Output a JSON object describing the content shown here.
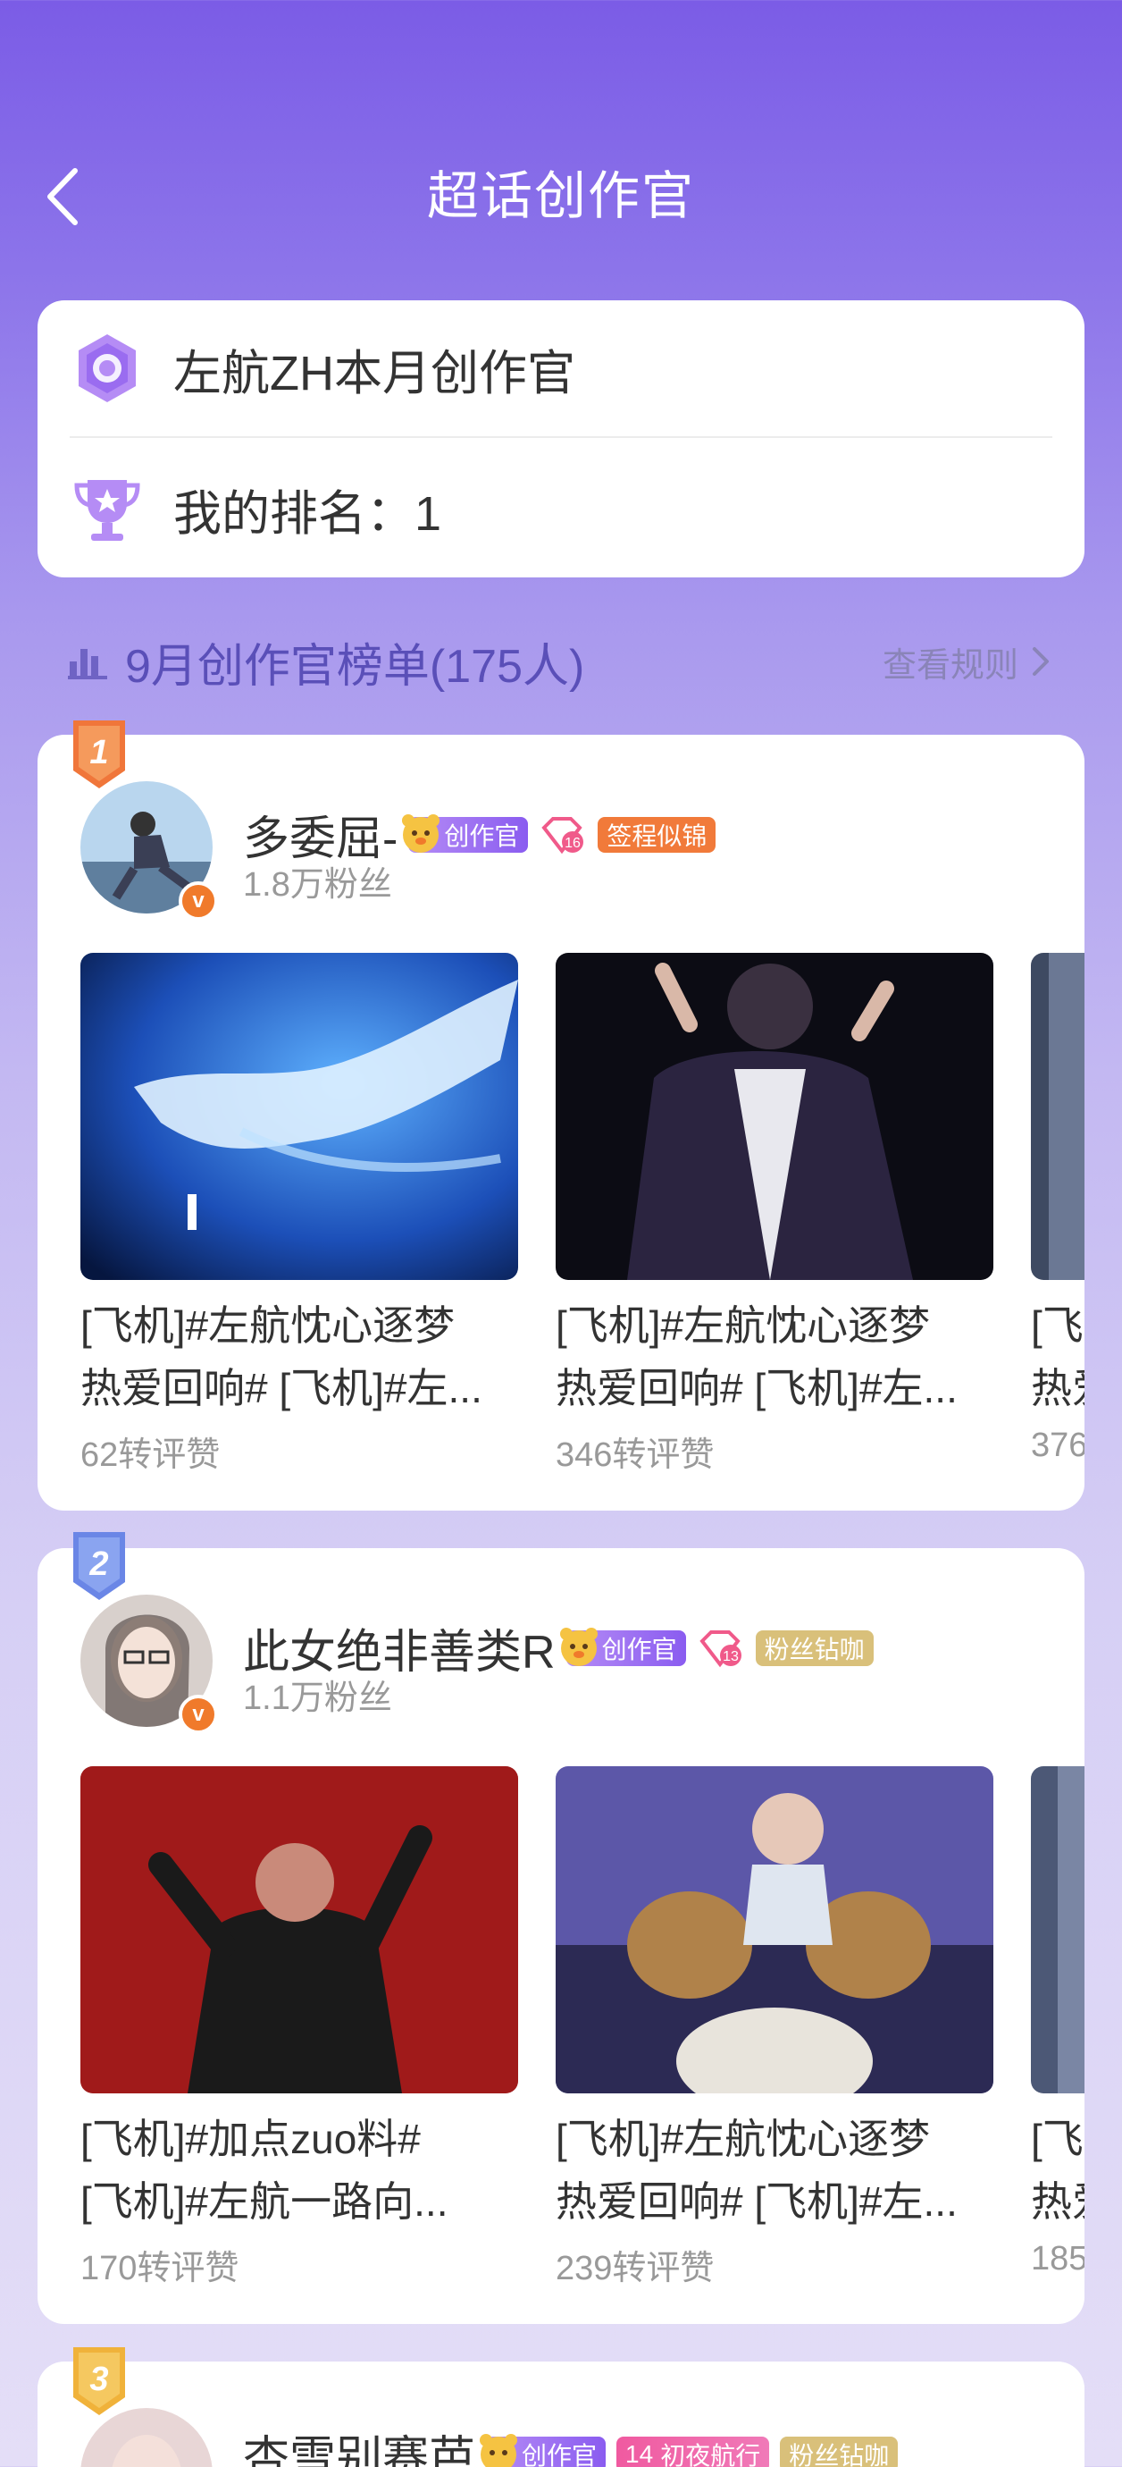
{
  "header": {
    "title": "超话创作官"
  },
  "info": {
    "creator_label": "左航ZH本月创作官",
    "rank_label": "我的排名：1"
  },
  "section": {
    "title": "9月创作官榜单(175人)",
    "rules_link": "查看规则"
  },
  "colors": {
    "accent": "#7b5ce6",
    "orange": "#f17a3a"
  },
  "ranking": [
    {
      "rank": "1",
      "name": "多委屈-",
      "fans": "1.8万粉丝",
      "creator_tag": "创作官",
      "level": "16",
      "badge": "签程似锦",
      "posts": [
        {
          "line1": "[飞机]#左航忱心逐梦",
          "line2": "热爱回响# [飞机]#左...",
          "stats": "62转评赞"
        },
        {
          "line1": "[飞机]#左航忱心逐梦",
          "line2": "热爱回响# [飞机]#左...",
          "stats": "346转评赞"
        },
        {
          "line1": "[飞",
          "line2": "热爱",
          "stats": "376"
        }
      ]
    },
    {
      "rank": "2",
      "name": "此女绝非善类R",
      "fans": "1.1万粉丝",
      "creator_tag": "创作官",
      "level": "13",
      "badge": "粉丝钻咖",
      "posts": [
        {
          "line1": "[飞机]#加点zuo料#",
          "line2": "[飞机]#左航一路向...",
          "stats": "170转评赞"
        },
        {
          "line1": "[飞机]#左航忱心逐梦",
          "line2": "热爱回响# [飞机]#左...",
          "stats": "239转评赞"
        },
        {
          "line1": "[飞",
          "line2": "热爱",
          "stats": "185"
        }
      ]
    },
    {
      "rank": "3",
      "name": "杏雪别赛芭",
      "creator_tag": "创作官",
      "level": "14",
      "badge": "初夜航行",
      "badge2": "粉丝钻咖"
    }
  ]
}
